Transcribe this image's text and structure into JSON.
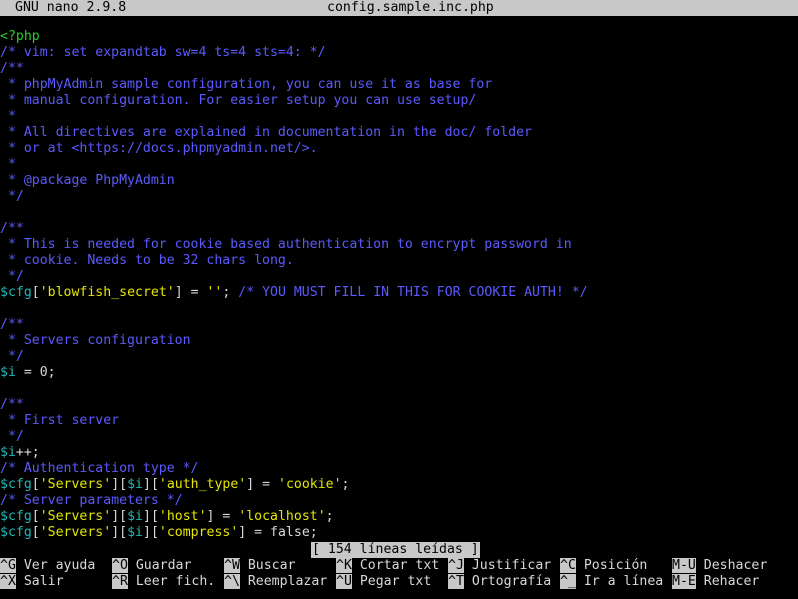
{
  "titlebar": {
    "app": "GNU nano 2.9.8",
    "filename": "config.sample.inc.php"
  },
  "editor": {
    "lines": [
      [
        [
          "<?php",
          "p"
        ]
      ],
      [
        [
          "/* vim: set expandtab sw=4 ts=4 sts=4: */",
          "c"
        ]
      ],
      [
        [
          "/**",
          "c"
        ]
      ],
      [
        [
          " * phpMyAdmin sample configuration, you can use it as base for",
          "c"
        ]
      ],
      [
        [
          " * manual configuration. For easier setup you can use setup/",
          "c"
        ]
      ],
      [
        [
          " *",
          "c"
        ]
      ],
      [
        [
          " * All directives are explained in documentation in the doc/ folder",
          "c"
        ]
      ],
      [
        [
          " * or at <https://docs.phpmyadmin.net/>.",
          "c"
        ]
      ],
      [
        [
          " *",
          "c"
        ]
      ],
      [
        [
          " * @package PhpMyAdmin",
          "c"
        ]
      ],
      [
        [
          " */",
          "c"
        ]
      ],
      [],
      [
        [
          "/**",
          "c"
        ]
      ],
      [
        [
          " * This is needed for cookie based authentication to encrypt password in",
          "c"
        ]
      ],
      [
        [
          " * cookie. Needs to be 32 chars long.",
          "c"
        ]
      ],
      [
        [
          " */",
          "c"
        ]
      ],
      [
        [
          "$",
          "v"
        ],
        [
          "cfg",
          "v"
        ],
        [
          "[",
          "t"
        ],
        [
          "'blowfish_secret'",
          "s"
        ],
        [
          "] = ",
          "t"
        ],
        [
          "''",
          "s"
        ],
        [
          "; ",
          "t"
        ],
        [
          "/* YOU MUST FILL IN THIS FOR COOKIE AUTH! */",
          "c"
        ]
      ],
      [],
      [
        [
          "/**",
          "c"
        ]
      ],
      [
        [
          " * Servers configuration",
          "c"
        ]
      ],
      [
        [
          " */",
          "c"
        ]
      ],
      [
        [
          "$",
          "v"
        ],
        [
          "i",
          "v"
        ],
        [
          " = 0;",
          "t"
        ]
      ],
      [],
      [
        [
          "/**",
          "c"
        ]
      ],
      [
        [
          " * First server",
          "c"
        ]
      ],
      [
        [
          " */",
          "c"
        ]
      ],
      [
        [
          "$",
          "v"
        ],
        [
          "i",
          "v"
        ],
        [
          "++;",
          "t"
        ]
      ],
      [
        [
          "/* Authentication type */",
          "c"
        ]
      ],
      [
        [
          "$",
          "v"
        ],
        [
          "cfg",
          "v"
        ],
        [
          "[",
          "t"
        ],
        [
          "'Servers'",
          "s"
        ],
        [
          "][",
          "t"
        ],
        [
          "$",
          "v"
        ],
        [
          "i",
          "v"
        ],
        [
          "][",
          "t"
        ],
        [
          "'auth_type'",
          "s"
        ],
        [
          "] = ",
          "t"
        ],
        [
          "'cookie'",
          "s"
        ],
        [
          ";",
          "t"
        ]
      ],
      [
        [
          "/* Server parameters */",
          "c"
        ]
      ],
      [
        [
          "$",
          "v"
        ],
        [
          "cfg",
          "v"
        ],
        [
          "[",
          "t"
        ],
        [
          "'Servers'",
          "s"
        ],
        [
          "][",
          "t"
        ],
        [
          "$",
          "v"
        ],
        [
          "i",
          "v"
        ],
        [
          "][",
          "t"
        ],
        [
          "'host'",
          "s"
        ],
        [
          "] = ",
          "t"
        ],
        [
          "'localhost'",
          "s"
        ],
        [
          ";",
          "t"
        ]
      ],
      [
        [
          "$",
          "v"
        ],
        [
          "cfg",
          "v"
        ],
        [
          "[",
          "t"
        ],
        [
          "'Servers'",
          "s"
        ],
        [
          "][",
          "t"
        ],
        [
          "$",
          "v"
        ],
        [
          "i",
          "v"
        ],
        [
          "][",
          "t"
        ],
        [
          "'compress'",
          "s"
        ],
        [
          "] = false;",
          "t"
        ]
      ]
    ]
  },
  "status": "[ 154 líneas leídas ]",
  "shortcuts": {
    "row1": [
      {
        "key": "^G",
        "label": "Ver ayuda"
      },
      {
        "key": "^O",
        "label": "Guardar"
      },
      {
        "key": "^W",
        "label": "Buscar"
      },
      {
        "key": "^K",
        "label": "Cortar txt"
      },
      {
        "key": "^J",
        "label": "Justificar"
      },
      {
        "key": "^C",
        "label": "Posición"
      },
      {
        "key": "M-U",
        "label": "Deshacer"
      }
    ],
    "row2": [
      {
        "key": "^X",
        "label": "Salir"
      },
      {
        "key": "^R",
        "label": "Leer fich."
      },
      {
        "key": "^\\",
        "label": "Reemplazar"
      },
      {
        "key": "^U",
        "label": "Pegar txt"
      },
      {
        "key": "^T",
        "label": "Ortografía"
      },
      {
        "key": "^_",
        "label": "Ir a línea"
      },
      {
        "key": "M-E",
        "label": "Rehacer"
      }
    ]
  }
}
